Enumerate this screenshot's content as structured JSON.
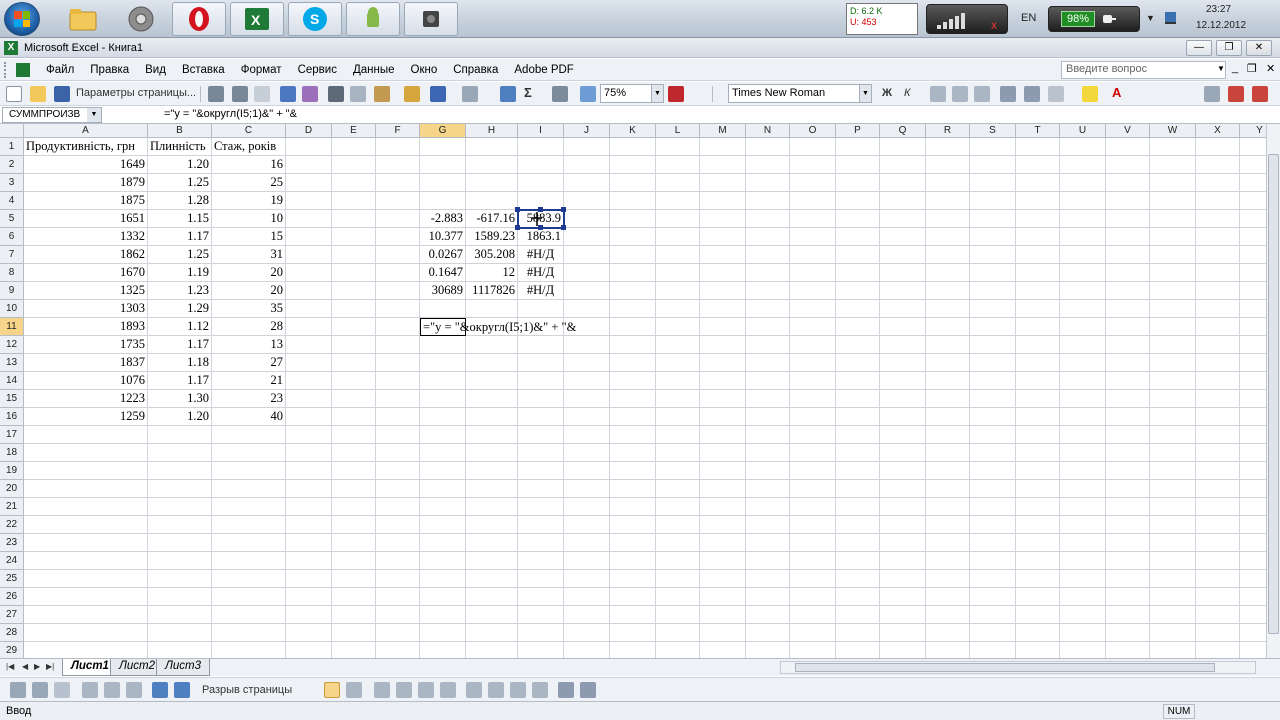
{
  "taskbar": {
    "net_down": "D: 6.2 K",
    "net_up": "U: 453",
    "lang": "EN",
    "battery": "98%",
    "time": "23:27",
    "date": "12.12.2012"
  },
  "window": {
    "title": "Microsoft Excel - Книга1"
  },
  "menu": [
    "Файл",
    "Правка",
    "Вид",
    "Вставка",
    "Формат",
    "Сервис",
    "Данные",
    "Окно",
    "Справка",
    "Adobe PDF"
  ],
  "help_placeholder": "Введите вопрос",
  "toolbar": {
    "page_setup": "Параметры страницы...",
    "zoom": "75%",
    "font": "Times New Roman"
  },
  "formula_bar": {
    "name_box": "СУММПРОИЗВ",
    "content": "=\"y = \"&округл(I5;1)&\" + \"&"
  },
  "columns": [
    "A",
    "B",
    "C",
    "D",
    "E",
    "F",
    "G",
    "H",
    "I",
    "J",
    "K",
    "L",
    "M",
    "N",
    "O",
    "P",
    "Q",
    "R",
    "S",
    "T",
    "U",
    "V",
    "W",
    "X",
    "Y"
  ],
  "rows": [
    "1",
    "2",
    "3",
    "4",
    "5",
    "6",
    "7",
    "8",
    "9",
    "10",
    "11",
    "12",
    "13",
    "14",
    "15",
    "16",
    "17",
    "18",
    "19",
    "20",
    "21",
    "22",
    "23",
    "24",
    "25",
    "26",
    "27",
    "28",
    "29"
  ],
  "headers": {
    "A1": "Продуктивність, грн",
    "B1": "Плинність",
    "C1": "Стаж, років"
  },
  "table": [
    [
      "1649",
      "1.20",
      "16"
    ],
    [
      "1879",
      "1.25",
      "25"
    ],
    [
      "1875",
      "1.28",
      "19"
    ],
    [
      "1651",
      "1.15",
      "10"
    ],
    [
      "1332",
      "1.17",
      "15"
    ],
    [
      "1862",
      "1.25",
      "31"
    ],
    [
      "1670",
      "1.19",
      "20"
    ],
    [
      "1325",
      "1.23",
      "20"
    ],
    [
      "1303",
      "1.29",
      "35"
    ],
    [
      "1893",
      "1.12",
      "28"
    ],
    [
      "1735",
      "1.17",
      "13"
    ],
    [
      "1837",
      "1.18",
      "27"
    ],
    [
      "1076",
      "1.17",
      "21"
    ],
    [
      "1223",
      "1.30",
      "23"
    ],
    [
      "1259",
      "1.20",
      "40"
    ]
  ],
  "linest": [
    [
      "-2.883",
      "-617.16",
      "5883.9"
    ],
    [
      "10.377",
      "1589.23",
      "1863.1"
    ],
    [
      "0.0267",
      "305.208",
      "#Н/Д"
    ],
    [
      "0.1647",
      "12",
      "#Н/Д"
    ],
    [
      "30689",
      "1117826",
      "#Н/Д"
    ]
  ],
  "edit_cell": "=\"y = \"&округл(I5;1)&\" + \"&",
  "sheets": [
    "Лист1",
    "Лист2",
    "Лист3"
  ],
  "draw_toolbar": {
    "page_break": "Разрыв страницы"
  },
  "status": {
    "mode": "Ввод",
    "num": "NUM"
  }
}
